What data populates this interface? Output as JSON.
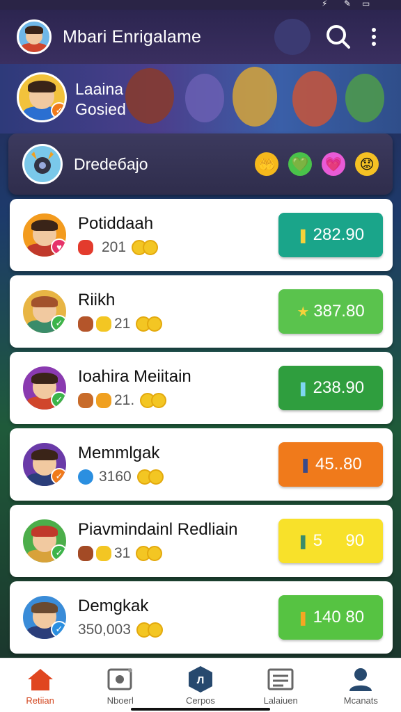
{
  "header": {
    "title": "Mbari Enrigalame",
    "search_icon": "search-icon",
    "menu_icon": "more-vertical-icon"
  },
  "banner": {
    "line1": "Laaina",
    "line2": "Gosied"
  },
  "highlight": {
    "title": "Dredeбajo",
    "emojis": [
      "🤲",
      "💚",
      "💗",
      "😟"
    ]
  },
  "rows": [
    {
      "name": "Potiddaah",
      "meta": "201",
      "price": "282.90",
      "color": "#1aa58a",
      "icon": "❚"
    },
    {
      "name": "Riikh",
      "meta": "21",
      "price": "387.80",
      "color": "#5ac34d",
      "icon": "★"
    },
    {
      "name": "Ioahira Meiitain",
      "meta": "21.",
      "price": "238.90",
      "color": "#2f9e3e",
      "icon": "❚"
    },
    {
      "name": "Memmlgak",
      "meta": "3160",
      "price": "45..80",
      "color": "#f07a1b",
      "icon": "❚"
    },
    {
      "name": "Piavmindainl Redliain",
      "meta": "31",
      "price": "5     90",
      "color": "#f8e12a",
      "icon": "❚"
    },
    {
      "name": "Demgkak",
      "meta": "350,003",
      "price": "140 80",
      "color": "#56c342",
      "icon": "❚"
    }
  ],
  "nav": [
    {
      "label": "Retiian",
      "icon": "home-icon"
    },
    {
      "label": "Nboerl",
      "icon": "photo-icon"
    },
    {
      "label": "Cerpos",
      "icon": "logo-icon"
    },
    {
      "label": "Lalaiuen",
      "icon": "list-icon"
    },
    {
      "label": "Mcanats",
      "icon": "profile-icon"
    }
  ]
}
